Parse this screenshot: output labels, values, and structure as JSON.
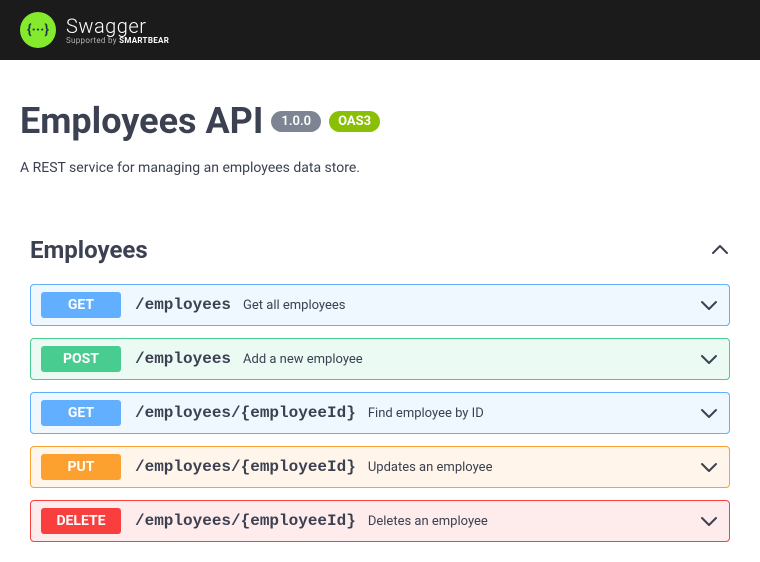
{
  "header": {
    "brand": "Swagger",
    "supported_prefix": "Supported by ",
    "supported_brand": "SMARTBEAR",
    "logo_glyph": "{···}"
  },
  "api": {
    "title": "Employees API",
    "version": "1.0.0",
    "oas_label": "OAS3",
    "description": "A REST service for managing an employees data store."
  },
  "tag": {
    "name": "Employees"
  },
  "operations": [
    {
      "method": "GET",
      "path": "/employees",
      "summary": "Get all employees",
      "method_class": "m-get",
      "row_class": "op-get"
    },
    {
      "method": "POST",
      "path": "/employees",
      "summary": "Add a new employee",
      "method_class": "m-post",
      "row_class": "op-post"
    },
    {
      "method": "GET",
      "path": "/employees/{employeeId}",
      "summary": "Find employee by ID",
      "method_class": "m-get",
      "row_class": "op-get"
    },
    {
      "method": "PUT",
      "path": "/employees/{employeeId}",
      "summary": "Updates an employee",
      "method_class": "m-put",
      "row_class": "op-put"
    },
    {
      "method": "DELETE",
      "path": "/employees/{employeeId}",
      "summary": "Deletes an employee",
      "method_class": "m-delete",
      "row_class": "op-delete"
    }
  ]
}
